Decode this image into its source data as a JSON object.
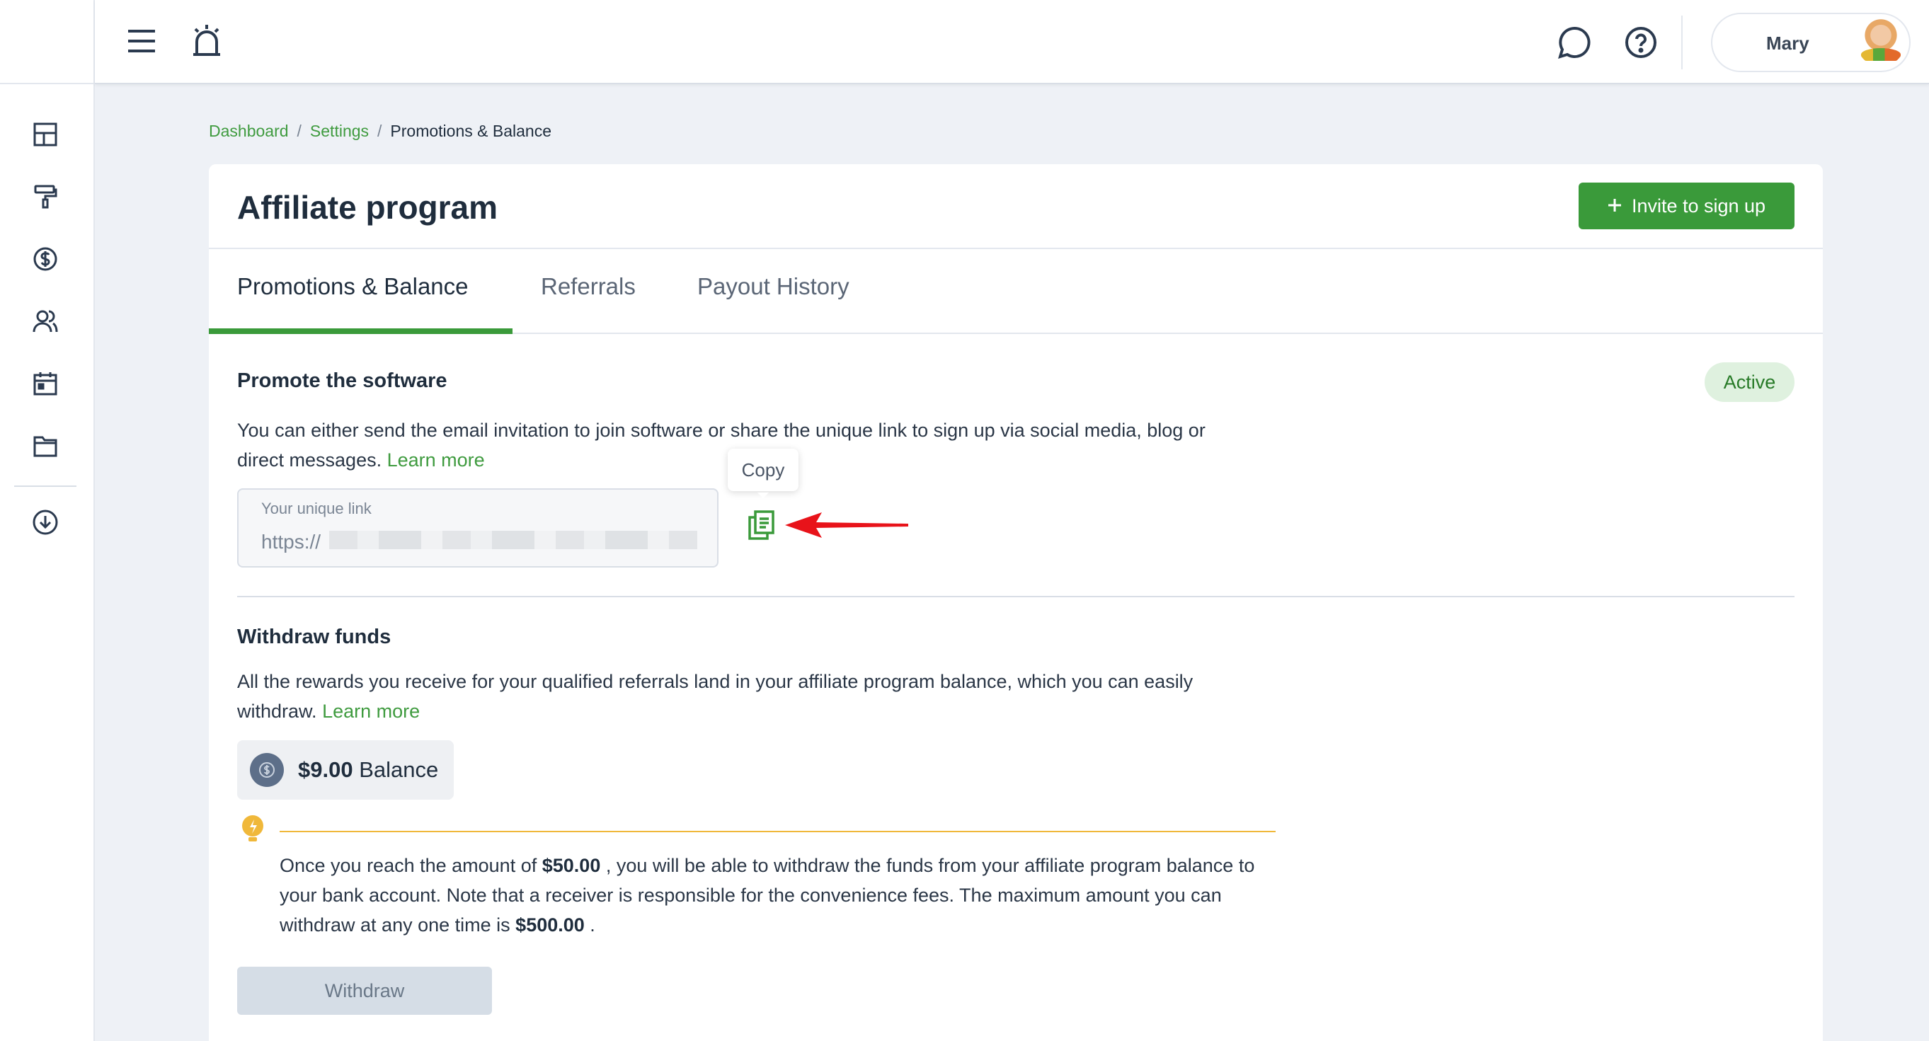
{
  "user": {
    "name": "Mary"
  },
  "breadcrumb": {
    "items": [
      "Dashboard",
      "Settings"
    ],
    "separator": "/",
    "current": "Promotions & Balance"
  },
  "page": {
    "title": "Affiliate program",
    "invite_button": "Invite to sign up"
  },
  "tabs": [
    {
      "label": "Promotions & Balance",
      "active": true
    },
    {
      "label": "Referrals",
      "active": false
    },
    {
      "label": "Payout History",
      "active": false
    }
  ],
  "promote": {
    "title": "Promote the software",
    "status": "Active",
    "description_line1": "You can either send the email invitation to join software or share the unique link to sign up via social media, blog or",
    "description_line2": "direct messages.",
    "learn_more": "Learn more",
    "link_label": "Your unique link",
    "link_value": "https://",
    "copy_tooltip": "Copy"
  },
  "withdraw": {
    "title": "Withdraw funds",
    "description_line1": "All the rewards you receive for your qualified referrals land in your affiliate program balance, which you can easily",
    "description_line2": "withdraw.",
    "learn_more": "Learn more",
    "balance_amount": "$9.00",
    "balance_label": "Balance",
    "notice": {
      "part1": "Once you reach the amount of",
      "min_amount": "$50.00",
      "part2": ", you will be able to withdraw the funds from your affiliate program balance to your bank account. Note that a receiver is responsible for the convenience fees. The maximum amount you can withdraw at any one time is",
      "max_amount": "$500.00",
      "part3": "."
    },
    "button": "Withdraw"
  },
  "icons": {
    "rail": [
      "dashboard-icon",
      "paint-roller-icon",
      "dollar-icon",
      "users-icon",
      "calendar-icon",
      "folder-icon",
      "cloud-download-icon"
    ],
    "topbar": [
      "menu-icon",
      "alarm-icon",
      "chat-icon",
      "help-icon"
    ]
  },
  "colors": {
    "accent": "#3a9a3a",
    "warning": "#f0b83a",
    "arrow": "#e8131a"
  }
}
